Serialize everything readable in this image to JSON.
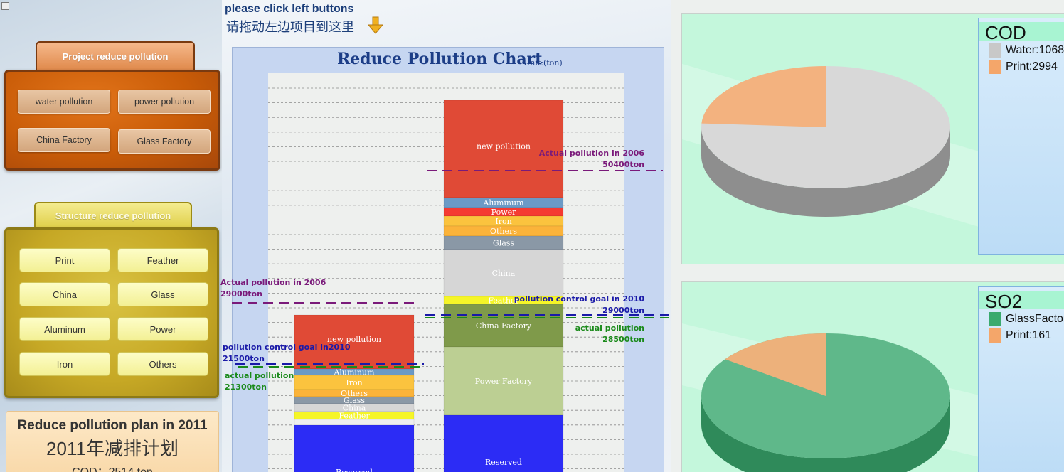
{
  "instruction": {
    "en": "please click left buttons",
    "cn": "请拖动左边项目到这里"
  },
  "project_group": {
    "title": "Project reduce pollution",
    "buttons": [
      "water pollution",
      "power pollution",
      "China Factory",
      "Glass Factory"
    ]
  },
  "structure_group": {
    "title": "Structure reduce pollution",
    "buttons": [
      "Print",
      "Feather",
      "China",
      "Glass",
      "Aluminum",
      "Power",
      "Iron",
      "Others"
    ]
  },
  "plan_card": {
    "title_en": "Reduce pollution plan in 2011",
    "title_cn": "2011年减排计划",
    "cod": "COD：2514 ton"
  },
  "chart_data": {
    "type": "bar",
    "title": "Reduce Pollution Chart",
    "unit": "Unit:(ton)",
    "bars": [
      {
        "segments": [
          {
            "label": "new pollution",
            "color": "#e04a36"
          },
          {
            "label": "Aluminum",
            "color": "#6b9ac6"
          },
          {
            "label": "Iron",
            "color": "#fbc33e"
          },
          {
            "label": "Others",
            "color": "#fbb33a"
          },
          {
            "label": "Glass",
            "color": "#8a98a6"
          },
          {
            "label": "China",
            "color": "#d6d6d6"
          },
          {
            "label": "Feather",
            "color": "#f5f528"
          },
          {
            "label": "",
            "color": "#efefef"
          },
          {
            "label": "Reserved",
            "color": "#2c2cf5"
          }
        ]
      },
      {
        "segments": [
          {
            "label": "new pollution",
            "color": "#e04a36"
          },
          {
            "label": "Aluminum",
            "color": "#6b9ac6"
          },
          {
            "label": "Power",
            "color": "#f53a32"
          },
          {
            "label": "Iron",
            "color": "#fbc33e"
          },
          {
            "label": "Others",
            "color": "#fbb33a"
          },
          {
            "label": "Glass",
            "color": "#8a98a6"
          },
          {
            "label": "China",
            "color": "#d6d6d6"
          },
          {
            "label": "Feather",
            "color": "#f5f528"
          },
          {
            "label": "China Factory",
            "color": "#7f9a4a"
          },
          {
            "label": "Power Factory",
            "color": "#bccf93"
          },
          {
            "label": "Reserved",
            "color": "#2c2cf5"
          }
        ]
      }
    ],
    "annotations": {
      "left_actual_2006": {
        "line1": "Actual pollution in 2006",
        "line2": "29000ton",
        "color": "#7a1a7a"
      },
      "left_goal_2010": {
        "line1": "pollution control goal in2010",
        "line2": "21500ton",
        "color": "#1a1aa8"
      },
      "left_actual": {
        "line1": "actual pollution",
        "line2": "21300ton",
        "color": "#1a8a1a"
      },
      "right_actual_2006": {
        "line1": "Actual pollution in 2006",
        "line2": "50400ton",
        "color": "#7a1a7a"
      },
      "right_goal_2010": {
        "line1": "pollution control goal in 2010",
        "line2": "29000ton",
        "color": "#1a1aa8"
      },
      "right_actual": {
        "line1": "actual pollution",
        "line2": "28500ton",
        "color": "#1a8a1a"
      }
    }
  },
  "pie_cod": {
    "title": "COD",
    "entries": [
      {
        "label": "Water:1068",
        "color": "#c8c8c8"
      },
      {
        "label": "Print:2994",
        "color": "#f4a66a"
      }
    ]
  },
  "pie_so2": {
    "title": "SO2",
    "entries": [
      {
        "label": "GlassFactor",
        "color": "#3aaa6e"
      },
      {
        "label": "Print:161",
        "color": "#f4a66a"
      }
    ]
  }
}
